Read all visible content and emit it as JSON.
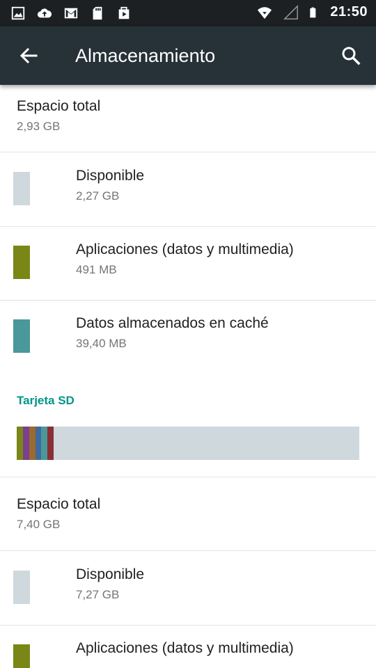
{
  "status_bar": {
    "time": "21:50",
    "icons": [
      "image-icon",
      "cloud-upload-icon",
      "gmail-icon",
      "sd-card-icon",
      "play-store-icon",
      "wifi-icon",
      "signal-icon",
      "battery-icon"
    ]
  },
  "app_bar": {
    "title": "Almacenamiento",
    "back_icon": "arrow-back-icon",
    "search_icon": "search-icon"
  },
  "internal": {
    "total": {
      "label": "Espacio total",
      "value": "2,93 GB"
    },
    "items": [
      {
        "label": "Disponible",
        "value": "2,27 GB",
        "color": "#cfd8dc"
      },
      {
        "label": "Aplicaciones (datos y multimedia)",
        "value": "491 MB",
        "color": "#7a8717"
      },
      {
        "label": "Datos almacenados en caché",
        "value": "39,40 MB",
        "color": "#4a9899"
      }
    ]
  },
  "sd_card": {
    "header": "Tarjeta SD",
    "usage_bar": {
      "background_color": "#cfd8dc",
      "segments": [
        {
          "color": "#7a8717",
          "fraction": 0.018
        },
        {
          "color": "#7b3f8f",
          "fraction": 0.018
        },
        {
          "color": "#9a6a2e",
          "fraction": 0.018
        },
        {
          "color": "#3f6aa0",
          "fraction": 0.018
        },
        {
          "color": "#4a9899",
          "fraction": 0.018
        },
        {
          "color": "#8a2f35",
          "fraction": 0.018
        }
      ]
    },
    "total": {
      "label": "Espacio total",
      "value": "7,40 GB"
    },
    "items": [
      {
        "label": "Disponible",
        "value": "7,27 GB",
        "color": "#cfd8dc"
      },
      {
        "label": "Aplicaciones (datos y multimedia)",
        "value": "",
        "color": "#7a8717"
      }
    ]
  }
}
